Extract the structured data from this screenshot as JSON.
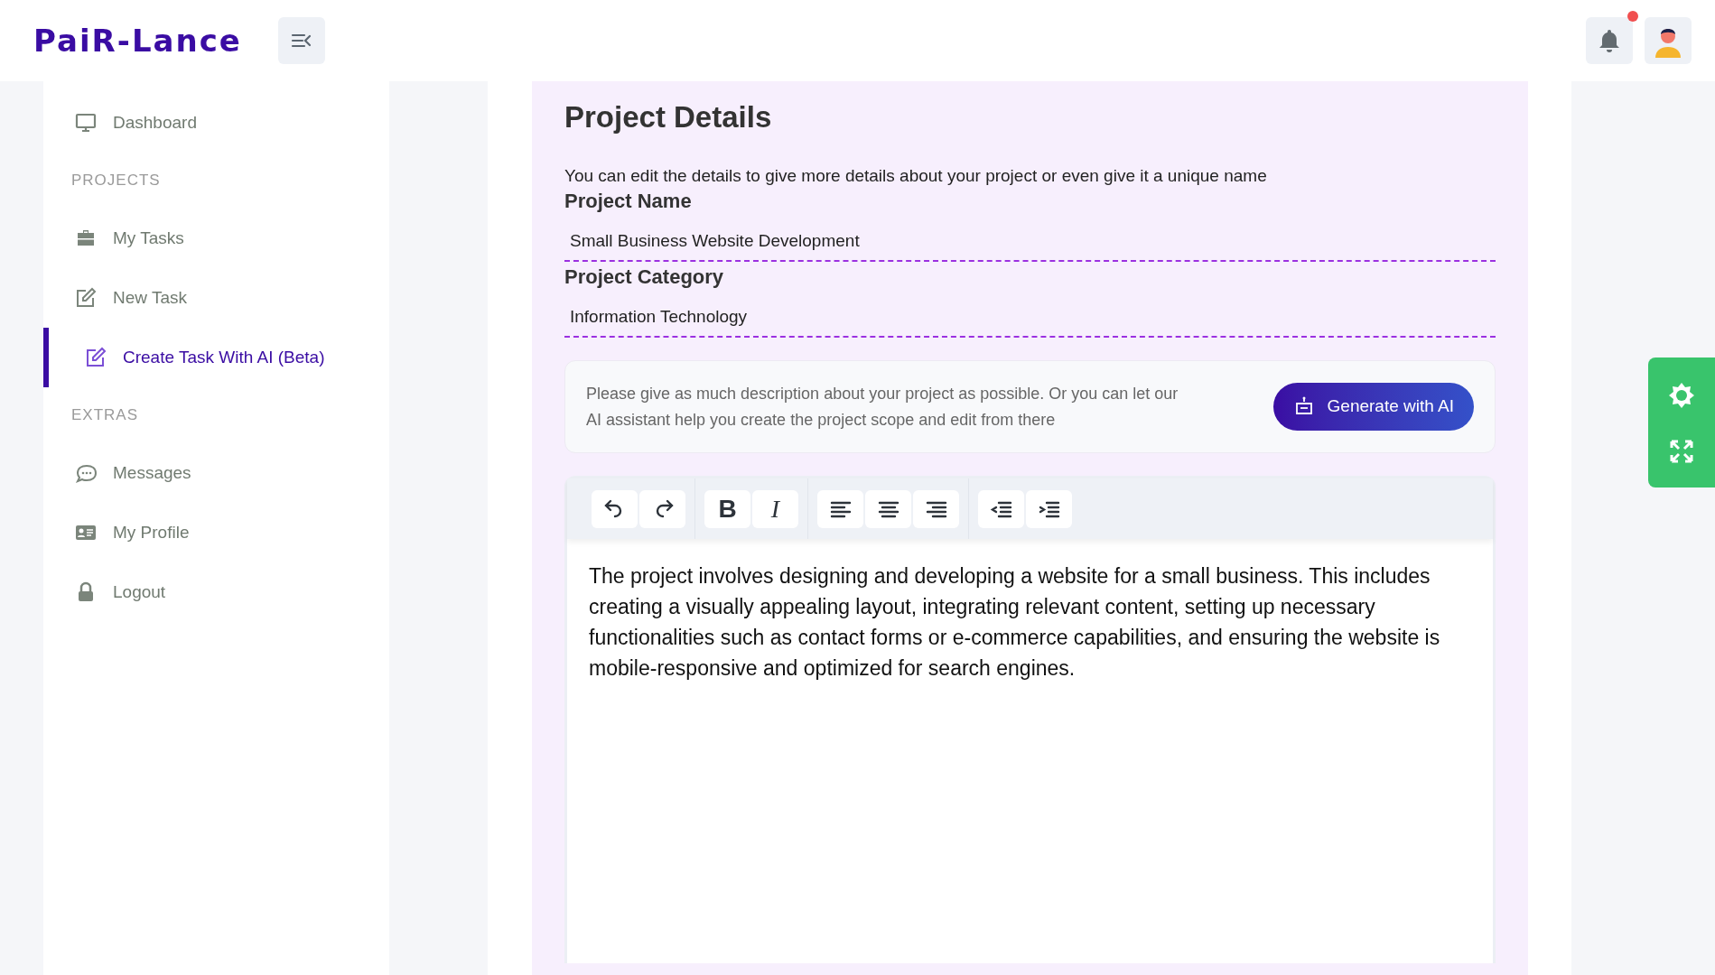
{
  "header": {
    "logo": "PaiR-Lance",
    "notifications": {
      "unread": true
    }
  },
  "sidebar": {
    "items": [
      {
        "kind": "link",
        "label": "Dashboard",
        "selected": false
      },
      {
        "kind": "heading",
        "label": "PROJECTS"
      },
      {
        "kind": "link",
        "label": "My Tasks",
        "selected": false
      },
      {
        "kind": "link",
        "label": "New Task",
        "selected": false
      },
      {
        "kind": "link",
        "label": "Create Task With AI (Beta)",
        "selected": true
      },
      {
        "kind": "heading",
        "label": "EXTRAS"
      },
      {
        "kind": "link",
        "label": "Messages",
        "selected": false
      },
      {
        "kind": "link",
        "label": "My Profile",
        "selected": false
      },
      {
        "kind": "link",
        "label": "Logout",
        "selected": false
      }
    ]
  },
  "form": {
    "title": "Project Details",
    "intro": "You can edit the details to give more details about your project or even give it a unique name",
    "fields": [
      {
        "label": "Project Name",
        "value": "Small Business Website Development"
      },
      {
        "label": "Project Category",
        "value": "Information Technology"
      }
    ],
    "ai_prompt": {
      "text": "Please give as much description about your project as possible. Or you can let our AI assistant help you create the project scope and edit from there",
      "button": "Generate with AI"
    },
    "editor": {
      "toolbar": [
        [
          {
            "kind": "undo"
          },
          {
            "kind": "redo"
          }
        ],
        [
          {
            "kind": "bold",
            "label": "B"
          },
          {
            "kind": "italic",
            "label": "I"
          }
        ],
        [
          {
            "kind": "left"
          },
          {
            "kind": "center"
          },
          {
            "kind": "right"
          }
        ],
        [
          {
            "kind": "outdent"
          },
          {
            "kind": "indent"
          }
        ]
      ],
      "content": "The project involves designing and developing a website for a small business. This includes creating a visually appealing layout, integrating relevant content, setting up necessary functionalities such as contact forms or e-commerce capabilities, and ensuring the website is mobile-responsive and optimized for search engines."
    }
  }
}
